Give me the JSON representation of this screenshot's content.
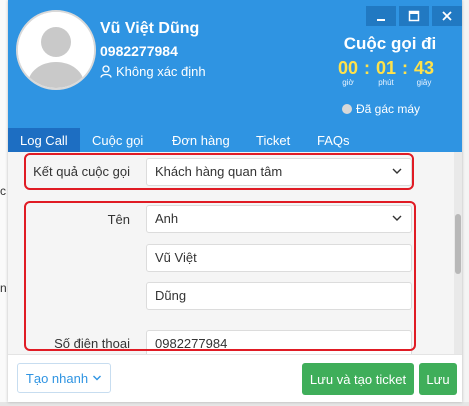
{
  "caller": {
    "name": "Vũ Việt Dũng",
    "phone": "0982277984",
    "status": "Không xác định"
  },
  "call": {
    "direction": "Cuộc gọi đi",
    "timer": {
      "hours": "00",
      "minutes": "01",
      "seconds": "43",
      "hours_label": "giờ",
      "minutes_label": "phút",
      "seconds_label": "giây"
    },
    "hangup_status": "Đã gác máy"
  },
  "tabs": [
    {
      "label": "Log Call",
      "active": true
    },
    {
      "label": "Cuộc gọi"
    },
    {
      "label": "Đơn hàng"
    },
    {
      "label": "Ticket"
    },
    {
      "label": "FAQs"
    }
  ],
  "form": {
    "call_result": {
      "label": "Kết quả cuộc gọi",
      "value": "Khách hàng quan tâm"
    },
    "name": {
      "label": "Tên",
      "title_value": "Anh",
      "last_name": "Vũ Việt",
      "first_name": "Dũng"
    },
    "phone": {
      "label": "Số điện thoại",
      "value": "0982277984"
    }
  },
  "footer": {
    "quick_create_label": "Tạo nhanh",
    "save_create_ticket_label": "Lưu và tạo ticket",
    "save_label": "Lưu"
  },
  "background": {
    "left_fragments": [
      "c",
      "n"
    ]
  },
  "colors": {
    "header": "#2f94e2",
    "active_tab": "#1d6ec2",
    "timer": "#ffe24a",
    "save_button": "#3fae5a",
    "highlight": "#e01b24"
  }
}
